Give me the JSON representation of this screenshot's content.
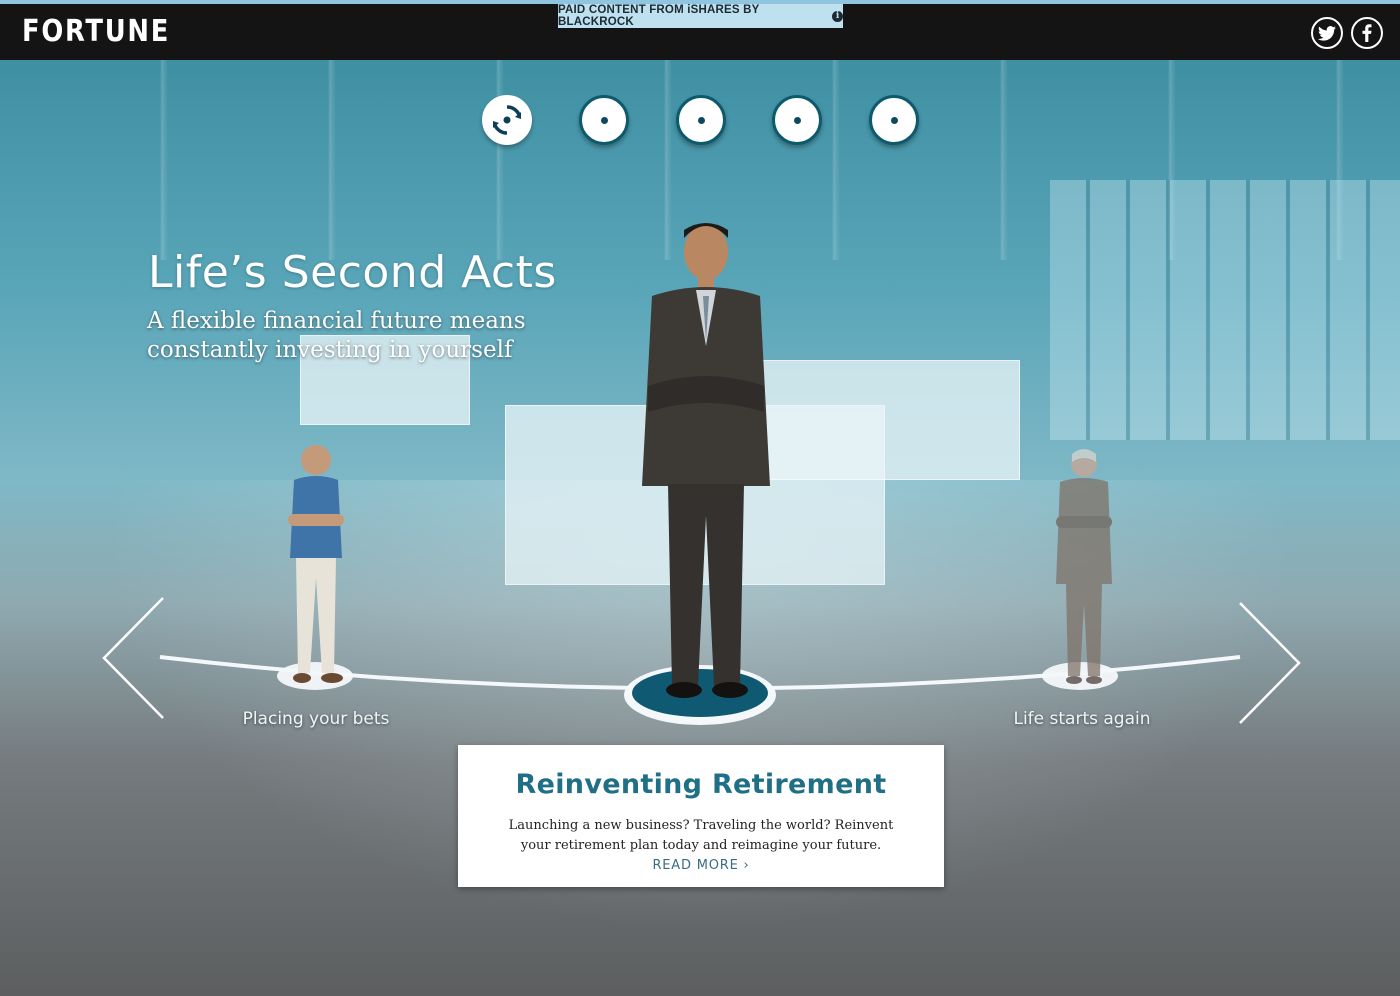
{
  "header": {
    "logo": "FORTUNE",
    "paid_badge": "PAID CONTENT FROM iSHARES BY BLACKROCK",
    "info_icon": "i",
    "social": [
      {
        "name": "twitter",
        "glyph": "t"
      },
      {
        "name": "facebook",
        "glyph": "f"
      }
    ]
  },
  "navigation": {
    "steps": 5,
    "active_index": 0
  },
  "hero": {
    "title": "Life’s Second Acts",
    "subtitle": "A flexible financial future means constantly investing in yourself"
  },
  "carousel": {
    "stages": [
      {
        "label": "Placing your bets",
        "position": "left"
      },
      {
        "label": "Reinventing Retirement",
        "position": "center",
        "active": true
      },
      {
        "label": "Life starts again",
        "position": "right"
      }
    ],
    "prev_icon": "chevron-left-icon",
    "next_icon": "chevron-right-icon"
  },
  "card": {
    "title": "Reinventing Retirement",
    "body": "Launching a new business? Traveling the world? Reinvent your retirement plan today and reimagine your future.",
    "read_more": "READ MORE ›"
  },
  "colors": {
    "accent": "#1f6f86",
    "header_bg": "#141414",
    "badge_bg": "#bfe0ee",
    "stage_active": "#0f5a72"
  }
}
